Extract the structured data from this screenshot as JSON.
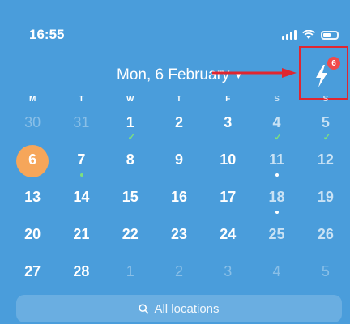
{
  "status_bar": {
    "time": "16:55"
  },
  "header": {
    "title": "Mon, 6 February",
    "badge_count": "6"
  },
  "weekdays": [
    "M",
    "T",
    "W",
    "T",
    "F",
    "S",
    "S"
  ],
  "weeks": [
    [
      {
        "n": "30"
      },
      {
        "n": "31"
      },
      {
        "n": "1"
      },
      {
        "n": "2"
      },
      {
        "n": "3"
      },
      {
        "n": "4"
      },
      {
        "n": "5"
      }
    ],
    [
      {
        "n": "6"
      },
      {
        "n": "7"
      },
      {
        "n": "8"
      },
      {
        "n": "9"
      },
      {
        "n": "10"
      },
      {
        "n": "11"
      },
      {
        "n": "12"
      }
    ],
    [
      {
        "n": "13"
      },
      {
        "n": "14"
      },
      {
        "n": "15"
      },
      {
        "n": "16"
      },
      {
        "n": "17"
      },
      {
        "n": "18"
      },
      {
        "n": "19"
      }
    ],
    [
      {
        "n": "20"
      },
      {
        "n": "21"
      },
      {
        "n": "22"
      },
      {
        "n": "23"
      },
      {
        "n": "24"
      },
      {
        "n": "25"
      },
      {
        "n": "26"
      }
    ],
    [
      {
        "n": "27"
      },
      {
        "n": "28"
      },
      {
        "n": "1"
      },
      {
        "n": "2"
      },
      {
        "n": "3"
      },
      {
        "n": "4"
      },
      {
        "n": "5"
      }
    ]
  ],
  "search": {
    "label": "All locations"
  },
  "colors": {
    "background": "#4a9ddb",
    "today": "#f6a65a",
    "highlight": "#e02630",
    "check": "#7ee07e"
  }
}
